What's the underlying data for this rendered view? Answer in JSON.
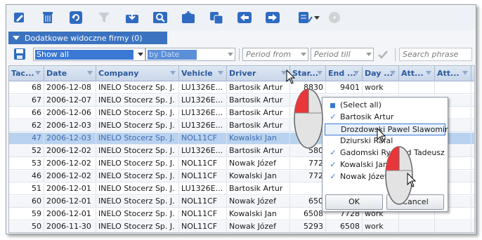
{
  "companies_bar": {
    "label": "Dodatkowe widoczne firmy (0)"
  },
  "filters": {
    "show": "Show all",
    "sort": "by Date",
    "period_from": "Period from",
    "period_till": "Period till",
    "search_placeholder": "Search phrase"
  },
  "toolbar_icons": [
    "edit-icon",
    "delete-icon",
    "refresh-icon",
    "filter-off-icon",
    "import-icon",
    "find-icon",
    "add-column-icon",
    "copy-icon",
    "back-icon",
    "forward-icon",
    "checklist-icon",
    "chevron-down-icon",
    "disc-icon"
  ],
  "columns": [
    "Tac...",
    "Date",
    "Company",
    "Vehicle",
    "Driver",
    "Star...",
    "End ...",
    "Day ...",
    "Att...",
    "Att..."
  ],
  "rows": [
    {
      "tac": "68",
      "date": "2006-12-08",
      "company": "INELO Stocerz Sp. J.",
      "vehicle": "LU1326E...",
      "driver": "Bartosik Artur",
      "start": "8830",
      "end": "9401",
      "day": "work"
    },
    {
      "tac": "67",
      "date": "2006-12-07",
      "company": "INELO Stocerz Sp. J.",
      "vehicle": "LU1326E...",
      "driver": "Bartosik Artur",
      "start": "",
      "end": "",
      "day": ""
    },
    {
      "tac": "66",
      "date": "2006-12-06",
      "company": "INELO Stocerz Sp. J.",
      "vehicle": "LU1326E...",
      "driver": "Bartosik Artur",
      "start": "",
      "end": "",
      "day": ""
    },
    {
      "tac": "62",
      "date": "2006-12-03",
      "company": "INELO Stocerz Sp. J.",
      "vehicle": "LU1326E...",
      "driver": "Bartosik Artur",
      "start": "",
      "end": "",
      "day": ""
    },
    {
      "tac": "47",
      "date": "2006-12-03",
      "company": "INELO Stocerz Sp. J.",
      "vehicle": "NOL11CF",
      "driver": "Kowalski Jan",
      "start": "",
      "end": "",
      "day": ""
    },
    {
      "tac": "52",
      "date": "2006-12-02",
      "company": "INELO Stocerz Sp. J.",
      "vehicle": "LU1326E...",
      "driver": "Bartosik Artur",
      "start": "580",
      "end": "",
      "day": ""
    },
    {
      "tac": "53",
      "date": "2006-12-02",
      "company": "INELO Stocerz Sp. J.",
      "vehicle": "NOL11CF",
      "driver": "Nowak Józef",
      "start": "772",
      "end": "",
      "day": ""
    },
    {
      "tac": "46",
      "date": "2006-12-02",
      "company": "INELO Stocerz Sp. J.",
      "vehicle": "NOL11CF",
      "driver": "Kowalski Jan",
      "start": "772",
      "end": "",
      "day": ""
    },
    {
      "tac": "51",
      "date": "2006-12-01",
      "company": "INELO Stocerz Sp. J.",
      "vehicle": "LU1326E...",
      "driver": "Bartosik Artur",
      "start": "",
      "end": "",
      "day": ""
    },
    {
      "tac": "60",
      "date": "2006-12-01",
      "company": "INELO Stocerz Sp. J.",
      "vehicle": "NOL11CF",
      "driver": "Nowak Józef",
      "start": "650",
      "end": "",
      "day": ""
    },
    {
      "tac": "59",
      "date": "2006-12-01",
      "company": "INELO Stocerz Sp. J.",
      "vehicle": "NOL11CF",
      "driver": "Kowalski Jan",
      "start": "6508",
      "end": "7728",
      "day": "work"
    },
    {
      "tac": "50",
      "date": "2006-11-30",
      "company": "INELO Stocerz Sp. J.",
      "vehicle": "NOL11CF",
      "driver": "Nowak Józef",
      "start": "5293",
      "end": "6508",
      "day": "work"
    }
  ],
  "popup": {
    "items": [
      {
        "label": "(Select all)",
        "mark": "square"
      },
      {
        "label": "Bartosik Artur",
        "mark": "check"
      },
      {
        "label": "Drozdowski Pawel Slawomir",
        "mark": "none"
      },
      {
        "label": "Dziurski Rafal",
        "mark": "none"
      },
      {
        "label": "Gadomski Ryszard Tadeusz",
        "mark": "check"
      },
      {
        "label": "Kowalski Jan",
        "mark": "check"
      },
      {
        "label": "Nowak Józef",
        "mark": "check"
      }
    ],
    "ok_label": "OK",
    "cancel_label": "Cancel"
  },
  "colors": {
    "accent": "#3a78d4",
    "bar": "#3b73c0",
    "header_text": "#2b5a9e"
  }
}
